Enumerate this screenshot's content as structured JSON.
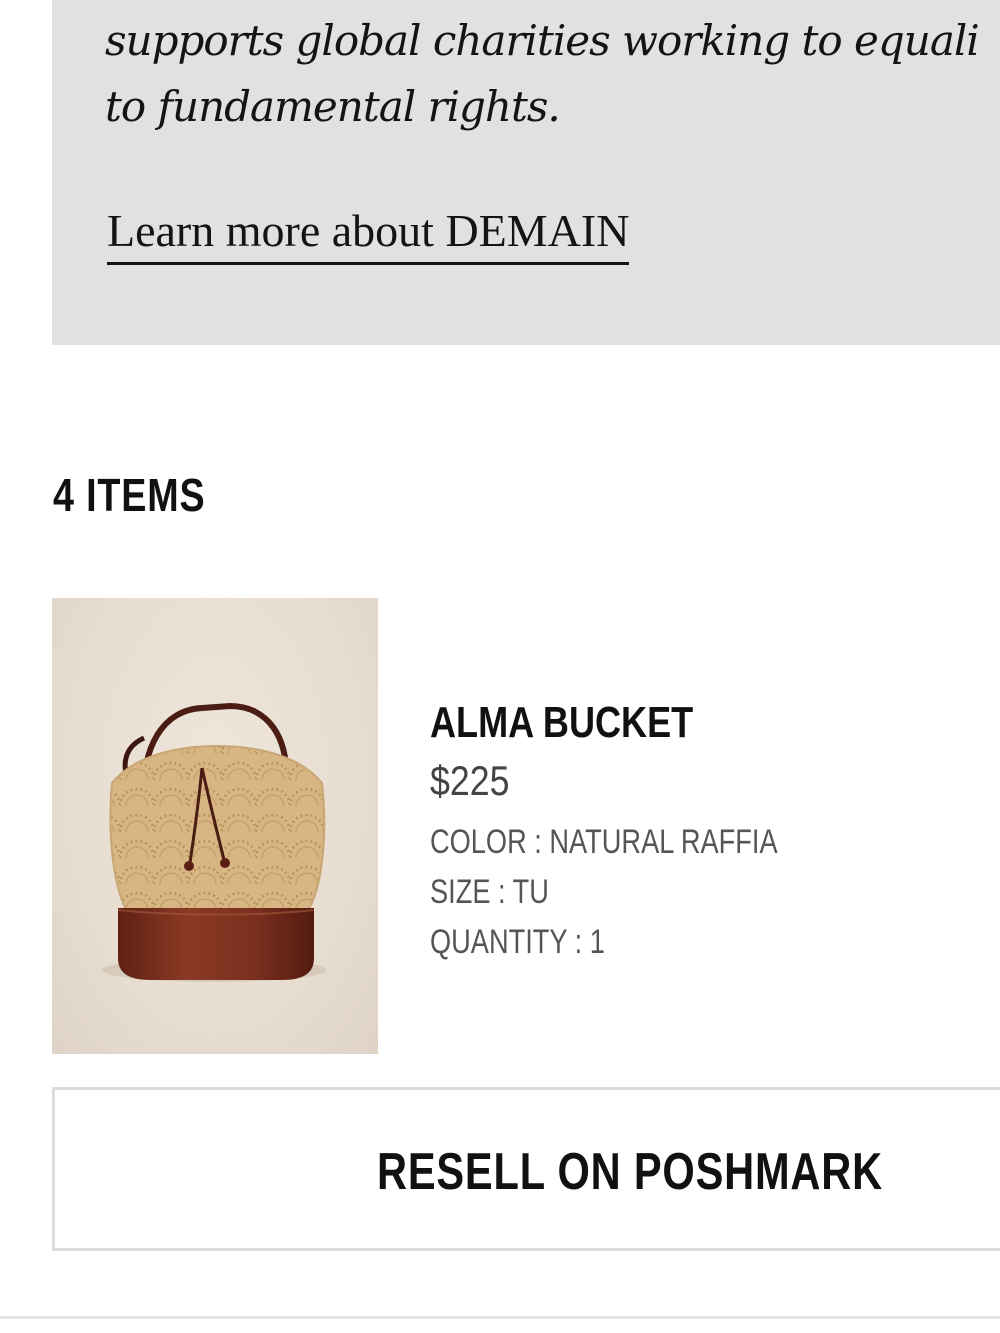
{
  "promo": {
    "line1": "supports global charities working to equali",
    "line2": "to fundamental rights.",
    "link_label": "Learn more about DEMAIN"
  },
  "cart": {
    "items_count_label": "4 ITEMS",
    "items": [
      {
        "name": "ALMA BUCKET",
        "price": "$225",
        "color": "COLOR : NATURAL RAFFIA",
        "size": "SIZE : TU",
        "quantity": "QUANTITY : 1",
        "image_icon": "raffia-bucket-bag-image"
      }
    ]
  },
  "actions": {
    "resell_label": "RESELL ON POSHMARK"
  },
  "colors": {
    "promo_background": "#e1e1e1",
    "text_primary": "#111111",
    "text_secondary": "#555555",
    "button_border": "#dcdcdc",
    "bag_raffia": "#d9b98a",
    "bag_leather": "#7a2f1f"
  }
}
